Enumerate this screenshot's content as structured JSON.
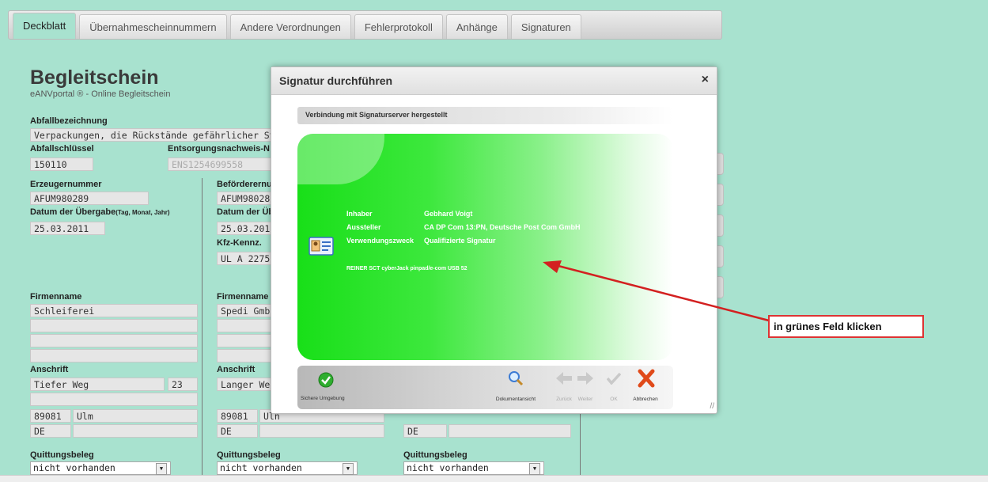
{
  "tabs": [
    "Deckblatt",
    "Übernahmescheinnummern",
    "Andere Verordnungen",
    "Fehlerprotokoll",
    "Anhänge",
    "Signaturen"
  ],
  "form": {
    "title": "Begleitschein",
    "subtitle": "eANVportal ® - Online Begleitschein",
    "abfallbezeichnung_label": "Abfallbezeichnung",
    "abfallbezeichnung_value": "Verpackungen, die Rückstände gefährlicher Stoffe en",
    "abfallschluessel_label": "Abfallschlüssel",
    "abfallschluessel_value": "150110",
    "entsorgungsnachweis_label": "Entsorgungsnachweis-N",
    "entsorgungsnachweis_value": "ENS1254699558",
    "erzeugernummer_label": "Erzeugernummer",
    "erzeugernummer_value": "AFUM980289",
    "befoerderernummer_label": "Beförderernu",
    "befoerderernummer_value": "AFUM98028",
    "datum_label": "Datum der Übergabe",
    "datum_hint": "(Tag, Monat, Jahr)",
    "datum_value": "25.03.2011",
    "datum2_label": "Datum der Üb",
    "datum2_value": "25.03.2011",
    "kfz_label": "Kfz-Kennz.",
    "kfz_value": "UL A 2275",
    "firmenname_label": "Firmenname",
    "firmenname1_value": "Schleiferei",
    "firmenname2_value": "Spedi GmbH",
    "anschrift_label": "Anschrift",
    "street1": "Tiefer Weg",
    "nr1": "23",
    "street2": "Langer Weg",
    "plz1": "89081",
    "city1": "Ulm",
    "plz2": "89081",
    "city2": "Uln",
    "country": "DE",
    "quittung_label": "Quittungsbeleg",
    "quittung_value": "nicht vorhanden"
  },
  "dialog": {
    "title": "Signatur durchführen",
    "close": "×",
    "status": "Verbindung mit Signaturserver hergestellt",
    "inhaber_label": "Inhaber",
    "inhaber_value": "Gebhard Voigt",
    "aussteller_label": "Aussteller",
    "aussteller_value": "CA DP Com 13:PN, Deutsche Post Com GmbH",
    "zweck_label": "Verwendungszweck",
    "zweck_value": "Qualifizierte Signatur",
    "reader": "REINER SCT cyberJack pinpad/e-com USB 52",
    "toolbar": {
      "secure": "Sichere Umgebung",
      "doc": "Dokumentansicht",
      "back": "Zurück",
      "next": "Weiter",
      "ok": "OK",
      "cancel": "Abbrechen"
    }
  },
  "callout": "in grünes Feld klicken",
  "colors": {
    "background": "#a8e2cf",
    "accent_green": "#18df18",
    "arrow": "#d32020"
  }
}
